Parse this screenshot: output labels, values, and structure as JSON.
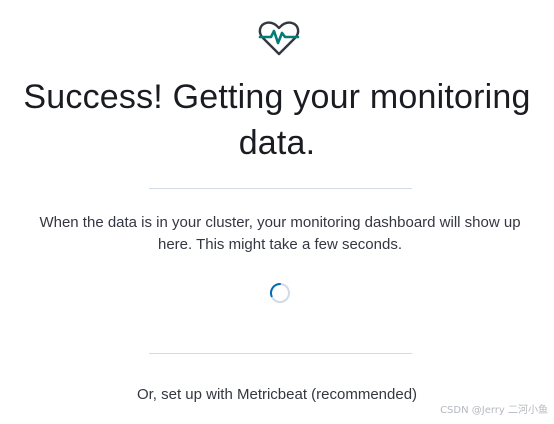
{
  "icon": "heart-monitor-icon",
  "title_line1": "Success! Getting your monitoring",
  "title_line2": "data.",
  "description_line1": "When the data is in your cluster, your monitoring dashboard will show up",
  "description_line2": "here. This might take a few seconds.",
  "spinner": "loading-spinner",
  "footer_link": "Or, set up with Metricbeat (recommended)",
  "watermark": "CSDN @Jerry 二河小鱼",
  "colors": {
    "icon_teal": "#017d73",
    "icon_dark": "#343741",
    "spinner_accent": "#006bb8",
    "spinner_track": "#d3dae6",
    "divider": "#d3dae6"
  }
}
